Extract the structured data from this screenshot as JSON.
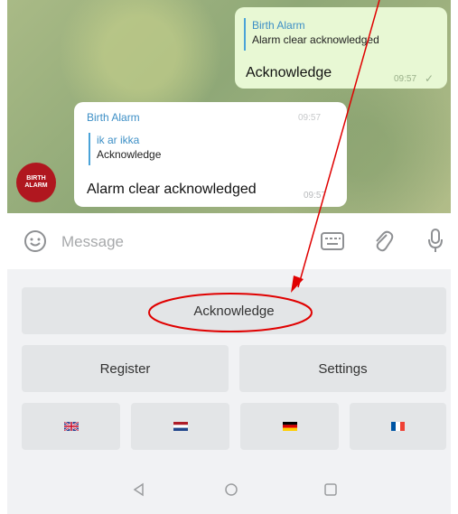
{
  "messages": {
    "outgoing": {
      "quote_name": "Birth Alarm",
      "quote_text": "Alarm clear acknowledged",
      "text": "Acknowledge",
      "time": "09:57"
    },
    "incoming": {
      "sender": "Birth Alarm",
      "quote_name": "ik ar ikka",
      "quote_text": "Acknowledge",
      "text": "Alarm clear acknowledged",
      "time": "09:57",
      "avatar_text": "BIRTH ALARM"
    }
  },
  "input": {
    "placeholder": "Message"
  },
  "keyboard": {
    "row1": [
      "Acknowledge"
    ],
    "row2": [
      "Register",
      "Settings"
    ],
    "flags": [
      "flag-uk-icon",
      "flag-nl-icon",
      "flag-de-icon",
      "flag-fr-icon"
    ]
  },
  "colors": {
    "annotation": "#e00000",
    "quote_accent": "#3d8fc6"
  }
}
